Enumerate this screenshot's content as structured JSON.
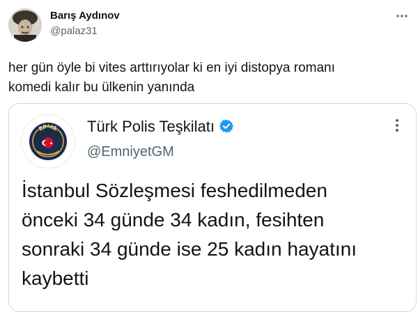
{
  "author": {
    "name": "Barış Aydınov",
    "handle": "@palaz31",
    "avatar_icon": "user-avatar-fur-hat"
  },
  "tweet": {
    "lines": [
      "her gün öyle bi vites arttırıyolar ki en iyi distopya romanı",
      "komedi kalır bu ülkenin yanında"
    ],
    "more_icon": "ellipsis-icon"
  },
  "quoted": {
    "name": "Türk Polis Teşkilatı",
    "handle": "@EmniyetGM",
    "verified": true,
    "verified_color": "#1d9bf0",
    "logo_text_top": "POLIS",
    "lines": [
      "İstanbul Sözleşmesi feshedilmeden",
      "önceki 34 günde 34 kadın, fesihten",
      "sonraki 34 günde ise 25 kadın hayatını",
      "kaybetti"
    ]
  }
}
